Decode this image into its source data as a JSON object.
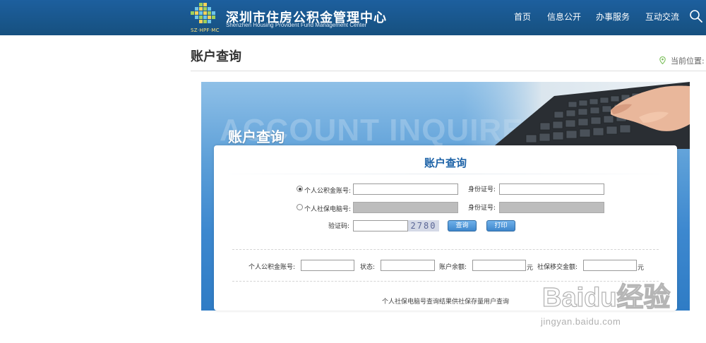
{
  "header": {
    "logo_caption": "SZ·HPF·MC",
    "title": "深圳市住房公积金管理中心",
    "subtitle": "Shenzhen Housing Provident Fund Management Center",
    "nav": [
      {
        "label": "首页"
      },
      {
        "label": "信息公开"
      },
      {
        "label": "办事服务"
      },
      {
        "label": "互动交流"
      }
    ],
    "search_icon": "search-icon"
  },
  "page": {
    "title": "账户查询",
    "location_label": "当前位置:"
  },
  "banner": {
    "bg_text": "ACCOUNT INQUIRE",
    "cn_text": "账户查询"
  },
  "form": {
    "card_title": "账户查询",
    "option_fund_account": {
      "label": "个人公积金账号:",
      "selected": true
    },
    "option_social_security": {
      "label": "个人社保电脑号:",
      "selected": false
    },
    "id_number_label_1": "身份证号:",
    "id_number_label_2": "身份证号:",
    "captcha_label": "验证码:",
    "captcha_value": "2780",
    "query_button": "查询",
    "print_button": "打印",
    "fund_account_value": "",
    "id_number_value": "",
    "captcha_input_value": ""
  },
  "result": {
    "account_label": "个人公积金账号:",
    "status_label": "状态:",
    "balance_label": "账户余额:",
    "balance_unit": "元",
    "transfer_label": "社保移交金额:",
    "transfer_unit": "元",
    "account_value": "",
    "status_value": "",
    "balance_value": "",
    "transfer_value": ""
  },
  "note": "个人社保电脑号查询结果供社保存量用户查询",
  "watermark": {
    "text": "Baidu经验",
    "url": "jingyan.baidu.com"
  },
  "colors": {
    "header_bg": "#1b5a96",
    "title_blue": "#1f64a8",
    "button_blue": "#3e86cc"
  }
}
